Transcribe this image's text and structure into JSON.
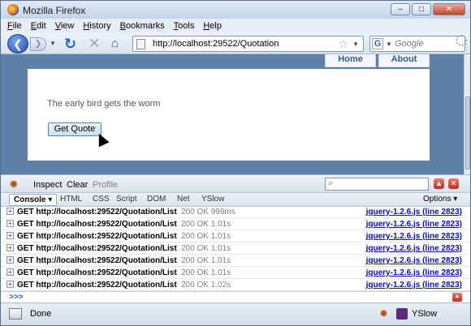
{
  "window": {
    "title": "Mozilla Firefox",
    "minimize": "–",
    "maximize": "□",
    "close": "✕"
  },
  "menu": [
    "File",
    "Edit",
    "View",
    "History",
    "Bookmarks",
    "Tools",
    "Help"
  ],
  "nav": {
    "url": "http://localhost:29522/Quotation",
    "search_placeholder": "Google",
    "search_engine": "G"
  },
  "page": {
    "nav_items": [
      "Home",
      "About"
    ],
    "text": "The early bird gets the worm",
    "button": "Get Quote"
  },
  "firebug": {
    "toolbar": {
      "inspect": "Inspect",
      "clear": "Clear",
      "profile": "Profile"
    },
    "tabs": [
      "Console ▾",
      "HTML",
      "CSS",
      "Script",
      "DOM",
      "Net",
      "YSlow"
    ],
    "options": "Options ▾",
    "log": [
      {
        "req": "GET http://localhost:29522/Quotation/List",
        "status": "200 OK 998ms",
        "src": "jquery-1.2.6.js (line 2823)"
      },
      {
        "req": "GET http://localhost:29522/Quotation/List",
        "status": "200 OK 1.01s",
        "src": "jquery-1.2.6.js (line 2823)"
      },
      {
        "req": "GET http://localhost:29522/Quotation/List",
        "status": "200 OK 1.01s",
        "src": "jquery-1.2.6.js (line 2823)"
      },
      {
        "req": "GET http://localhost:29522/Quotation/List",
        "status": "200 OK 1.01s",
        "src": "jquery-1.2.6.js (line 2823)"
      },
      {
        "req": "GET http://localhost:29522/Quotation/List",
        "status": "200 OK 1.01s",
        "src": "jquery-1.2.6.js (line 2823)"
      },
      {
        "req": "GET http://localhost:29522/Quotation/List",
        "status": "200 OK 1.01s",
        "src": "jquery-1.2.6.js (line 2823)"
      },
      {
        "req": "GET http://localhost:29522/Quotation/List",
        "status": "200 OK 1.02s",
        "src": "jquery-1.2.6.js (line 2823)"
      }
    ],
    "prompt": ">>>"
  },
  "status": {
    "text": "Done",
    "yslow": "YSlow"
  }
}
